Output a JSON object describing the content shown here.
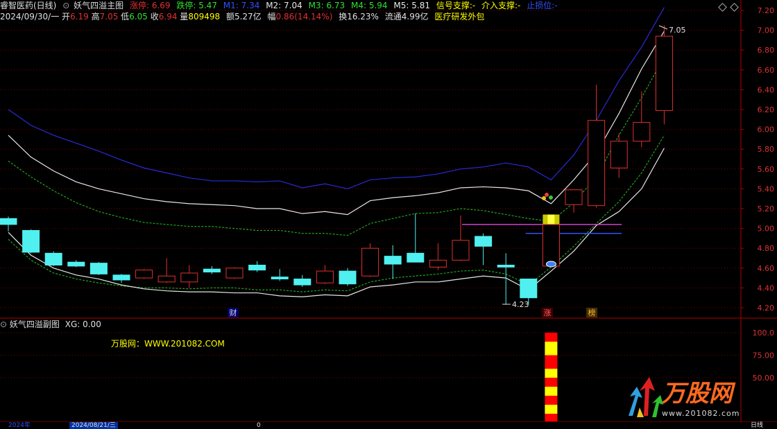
{
  "header": {
    "stock_name": "睿智医药(日线)",
    "indicator_name": "妖气四溢主图",
    "zt_label": "涨停:",
    "zt_value": "6.69",
    "dt_label": "跌停:",
    "dt_value": "5.47",
    "m1": "M1: 7.34",
    "m2": "M2: 7.04",
    "m3": "M3: 6.73",
    "m4": "M4: 5.94",
    "m5": "M5: 5.81",
    "signal": "信号支撑:-",
    "intervene": "介入支撑:-",
    "stop": "止损位:-"
  },
  "quote": {
    "date": "2024/09/30/一",
    "open_label": "开",
    "open": "6.19",
    "high_label": "高",
    "high": "7.05",
    "low_label": "低",
    "low": "6.05",
    "close_label": "收",
    "close": "6.94",
    "vol_label": "量",
    "vol": "809498",
    "amount": "额5.27亿",
    "amp_label": "幅",
    "amp": "0.86(14.14%)",
    "turnover": "换16.23%",
    "float": "流通4.99亿",
    "sector": "医疗研发外包"
  },
  "price_axis": {
    "labels": [
      "7.20",
      "7.00",
      "6.80",
      "6.60",
      "6.40",
      "6.20",
      "6.00",
      "5.80",
      "5.60",
      "5.40",
      "5.20",
      "5.00",
      "4.80",
      "4.60",
      "4.40",
      "4.20"
    ],
    "values": [
      7.2,
      7.0,
      6.8,
      6.6,
      6.4,
      6.2,
      6.0,
      5.8,
      5.6,
      5.4,
      5.2,
      5.0,
      4.8,
      4.6,
      4.4,
      4.2
    ]
  },
  "sub_axis": {
    "labels": [
      "100.0",
      "75.00",
      "50.00"
    ],
    "values": [
      100,
      75,
      50
    ]
  },
  "markers": {
    "high_mark": "7.05",
    "low_mark": "4.23",
    "cai": "财",
    "zhang": "涨",
    "bang": "榜"
  },
  "sub_panel": {
    "title": "妖气四溢副图",
    "xg": "XG: 0.00",
    "site": "万股网：WWW.201082.COM"
  },
  "watermark": {
    "brand": "万股网",
    "url": "www.201082.com"
  },
  "bottom": {
    "left": "2024年",
    "date": "2024/08/21/三",
    "num": "0",
    "right": "日线"
  },
  "colors": {
    "up": "#e03030",
    "down": "#50f0f0",
    "axis": "#d33",
    "grid": "#7a0000",
    "blue": "#2a2ad8",
    "white": "#e8e8e8",
    "green": "#1fa51f",
    "yellow": "#ffff00"
  },
  "chart_data": {
    "type": "candlestick",
    "candles": [
      {
        "o": 5.1,
        "h": 5.12,
        "l": 4.97,
        "c": 5.04
      },
      {
        "o": 4.98,
        "h": 4.99,
        "l": 4.75,
        "c": 4.76
      },
      {
        "o": 4.75,
        "h": 4.77,
        "l": 4.62,
        "c": 4.63
      },
      {
        "o": 4.66,
        "h": 4.68,
        "l": 4.61,
        "c": 4.62
      },
      {
        "o": 4.65,
        "h": 4.66,
        "l": 4.53,
        "c": 4.54
      },
      {
        "o": 4.53,
        "h": 4.54,
        "l": 4.45,
        "c": 4.48
      },
      {
        "o": 4.5,
        "h": 4.59,
        "l": 4.49,
        "c": 4.58
      },
      {
        "o": 4.46,
        "h": 4.7,
        "l": 4.45,
        "c": 4.52
      },
      {
        "o": 4.46,
        "h": 4.63,
        "l": 4.4,
        "c": 4.55
      },
      {
        "o": 4.59,
        "h": 4.62,
        "l": 4.54,
        "c": 4.56
      },
      {
        "o": 4.5,
        "h": 4.61,
        "l": 4.49,
        "c": 4.6
      },
      {
        "o": 4.63,
        "h": 4.67,
        "l": 4.56,
        "c": 4.58
      },
      {
        "o": 4.51,
        "h": 4.59,
        "l": 4.47,
        "c": 4.49
      },
      {
        "o": 4.49,
        "h": 4.53,
        "l": 4.41,
        "c": 4.43
      },
      {
        "o": 4.45,
        "h": 4.63,
        "l": 4.44,
        "c": 4.57
      },
      {
        "o": 4.57,
        "h": 4.6,
        "l": 4.42,
        "c": 4.44
      },
      {
        "o": 4.52,
        "h": 4.85,
        "l": 4.51,
        "c": 4.8
      },
      {
        "o": 4.72,
        "h": 4.83,
        "l": 4.49,
        "c": 4.64
      },
      {
        "o": 4.75,
        "h": 5.15,
        "l": 4.7,
        "c": 4.66
      },
      {
        "o": 4.61,
        "h": 4.85,
        "l": 4.58,
        "c": 4.68
      },
      {
        "o": 4.68,
        "h": 5.13,
        "l": 4.67,
        "c": 4.88
      },
      {
        "o": 4.92,
        "h": 4.95,
        "l": 4.63,
        "c": 4.82
      },
      {
        "o": 4.63,
        "h": 4.75,
        "l": 4.23,
        "c": 4.61
      },
      {
        "o": 4.49,
        "h": 4.49,
        "l": 4.23,
        "c": 4.3
      },
      {
        "o": 4.62,
        "h": 5.04,
        "l": 4.62,
        "c": 5.04
      },
      {
        "o": 5.24,
        "h": 5.38,
        "l": 5.16,
        "c": 5.39
      },
      {
        "o": 5.23,
        "h": 6.45,
        "l": 5.21,
        "c": 6.09
      },
      {
        "o": 5.61,
        "h": 5.96,
        "l": 5.51,
        "c": 5.88
      },
      {
        "o": 5.88,
        "h": 6.38,
        "l": 5.82,
        "c": 6.07
      },
      {
        "o": 6.19,
        "h": 7.05,
        "l": 6.05,
        "c": 6.94
      }
    ],
    "upper_blue": [
      6.2,
      6.04,
      5.94,
      5.86,
      5.78,
      5.69,
      5.61,
      5.56,
      5.51,
      5.48,
      5.48,
      5.47,
      5.48,
      5.41,
      5.45,
      5.4,
      5.49,
      5.51,
      5.52,
      5.55,
      5.6,
      5.62,
      5.66,
      5.62,
      5.49,
      5.74,
      6.09,
      6.49,
      6.83,
      7.23
    ],
    "upper_white": [
      5.94,
      5.72,
      5.58,
      5.47,
      5.4,
      5.35,
      5.3,
      5.27,
      5.25,
      5.24,
      5.23,
      5.2,
      5.2,
      5.15,
      5.17,
      5.14,
      5.28,
      5.31,
      5.33,
      5.36,
      5.41,
      5.42,
      5.41,
      5.38,
      5.25,
      5.49,
      5.76,
      6.16,
      6.61,
      6.99
    ],
    "mid_green": [
      5.68,
      5.52,
      5.38,
      5.26,
      5.17,
      5.11,
      5.06,
      5.04,
      5.02,
      5.02,
      5.0,
      4.98,
      4.98,
      4.95,
      4.95,
      4.93,
      5.05,
      5.1,
      5.15,
      5.16,
      5.2,
      5.18,
      5.14,
      5.1,
      5.07,
      5.26,
      5.52,
      5.94,
      6.32,
      6.73
    ],
    "lower_white": [
      4.96,
      4.73,
      4.6,
      4.53,
      4.49,
      4.43,
      4.39,
      4.37,
      4.36,
      4.36,
      4.35,
      4.35,
      4.32,
      4.31,
      4.33,
      4.32,
      4.41,
      4.43,
      4.46,
      4.46,
      4.49,
      4.52,
      4.5,
      4.38,
      4.57,
      4.77,
      5.03,
      5.17,
      5.4,
      5.81
    ],
    "lower_green": [
      4.89,
      4.68,
      4.55,
      4.49,
      4.45,
      4.42,
      4.4,
      4.4,
      4.39,
      4.4,
      4.4,
      4.38,
      4.38,
      4.36,
      4.38,
      4.37,
      4.46,
      4.5,
      4.52,
      4.54,
      4.57,
      4.58,
      4.54,
      4.43,
      4.61,
      4.82,
      5.05,
      5.27,
      5.56,
      5.94
    ],
    "magenta_line": {
      "price": 5.04,
      "from": 20,
      "to": 27
    },
    "blue_line": {
      "price": 4.95,
      "from": 23,
      "to": 27
    },
    "yellow_bar": {
      "index": 24,
      "top": 5.14,
      "bottom": 4.68
    },
    "sub_bar": {
      "index": 24,
      "segments": [
        100,
        90,
        75,
        60,
        50,
        40,
        30,
        20,
        10,
        0
      ]
    }
  }
}
